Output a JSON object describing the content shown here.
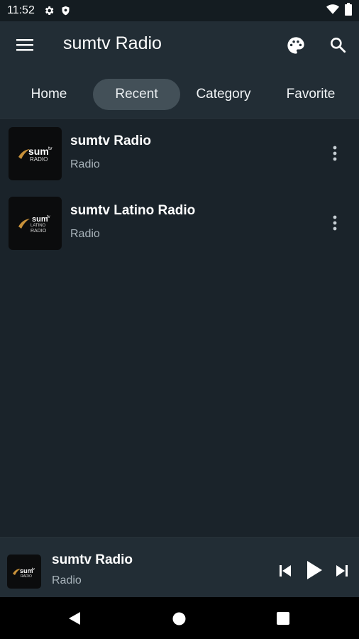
{
  "status_bar": {
    "time": "11:52",
    "icons": [
      "settings-gear-icon",
      "shield-icon",
      "wifi-icon",
      "battery-icon"
    ]
  },
  "app_bar": {
    "title": "sumtv Radio",
    "icons": [
      "menu-icon",
      "palette-icon",
      "search-icon"
    ]
  },
  "tabs": [
    {
      "label": "Home",
      "active": false
    },
    {
      "label": "Recent",
      "active": true
    },
    {
      "label": "Category",
      "active": false
    },
    {
      "label": "Favorite",
      "active": false
    }
  ],
  "stations": [
    {
      "name": "sumtv Radio",
      "type": "Radio",
      "logo_text": "sum",
      "logo_sup": "tv",
      "logo_sub": "RADIO"
    },
    {
      "name": "sumtv Latino Radio",
      "type": "Radio",
      "logo_text": "sum",
      "logo_sup": "tv",
      "logo_mid": "LATINO",
      "logo_sub": "RADIO"
    }
  ],
  "player": {
    "name": "sumtv Radio",
    "type": "Radio",
    "logo_text": "sum",
    "logo_sup": "tv",
    "logo_sub": "RADIO",
    "controls": [
      "skip-previous-icon",
      "play-icon",
      "skip-next-icon"
    ]
  },
  "colors": {
    "background": "#1a232a",
    "app_bar": "#222d35",
    "active_tab": "#435058",
    "subtext": "#a9b4bb",
    "logo_accent": "#c8913a"
  }
}
